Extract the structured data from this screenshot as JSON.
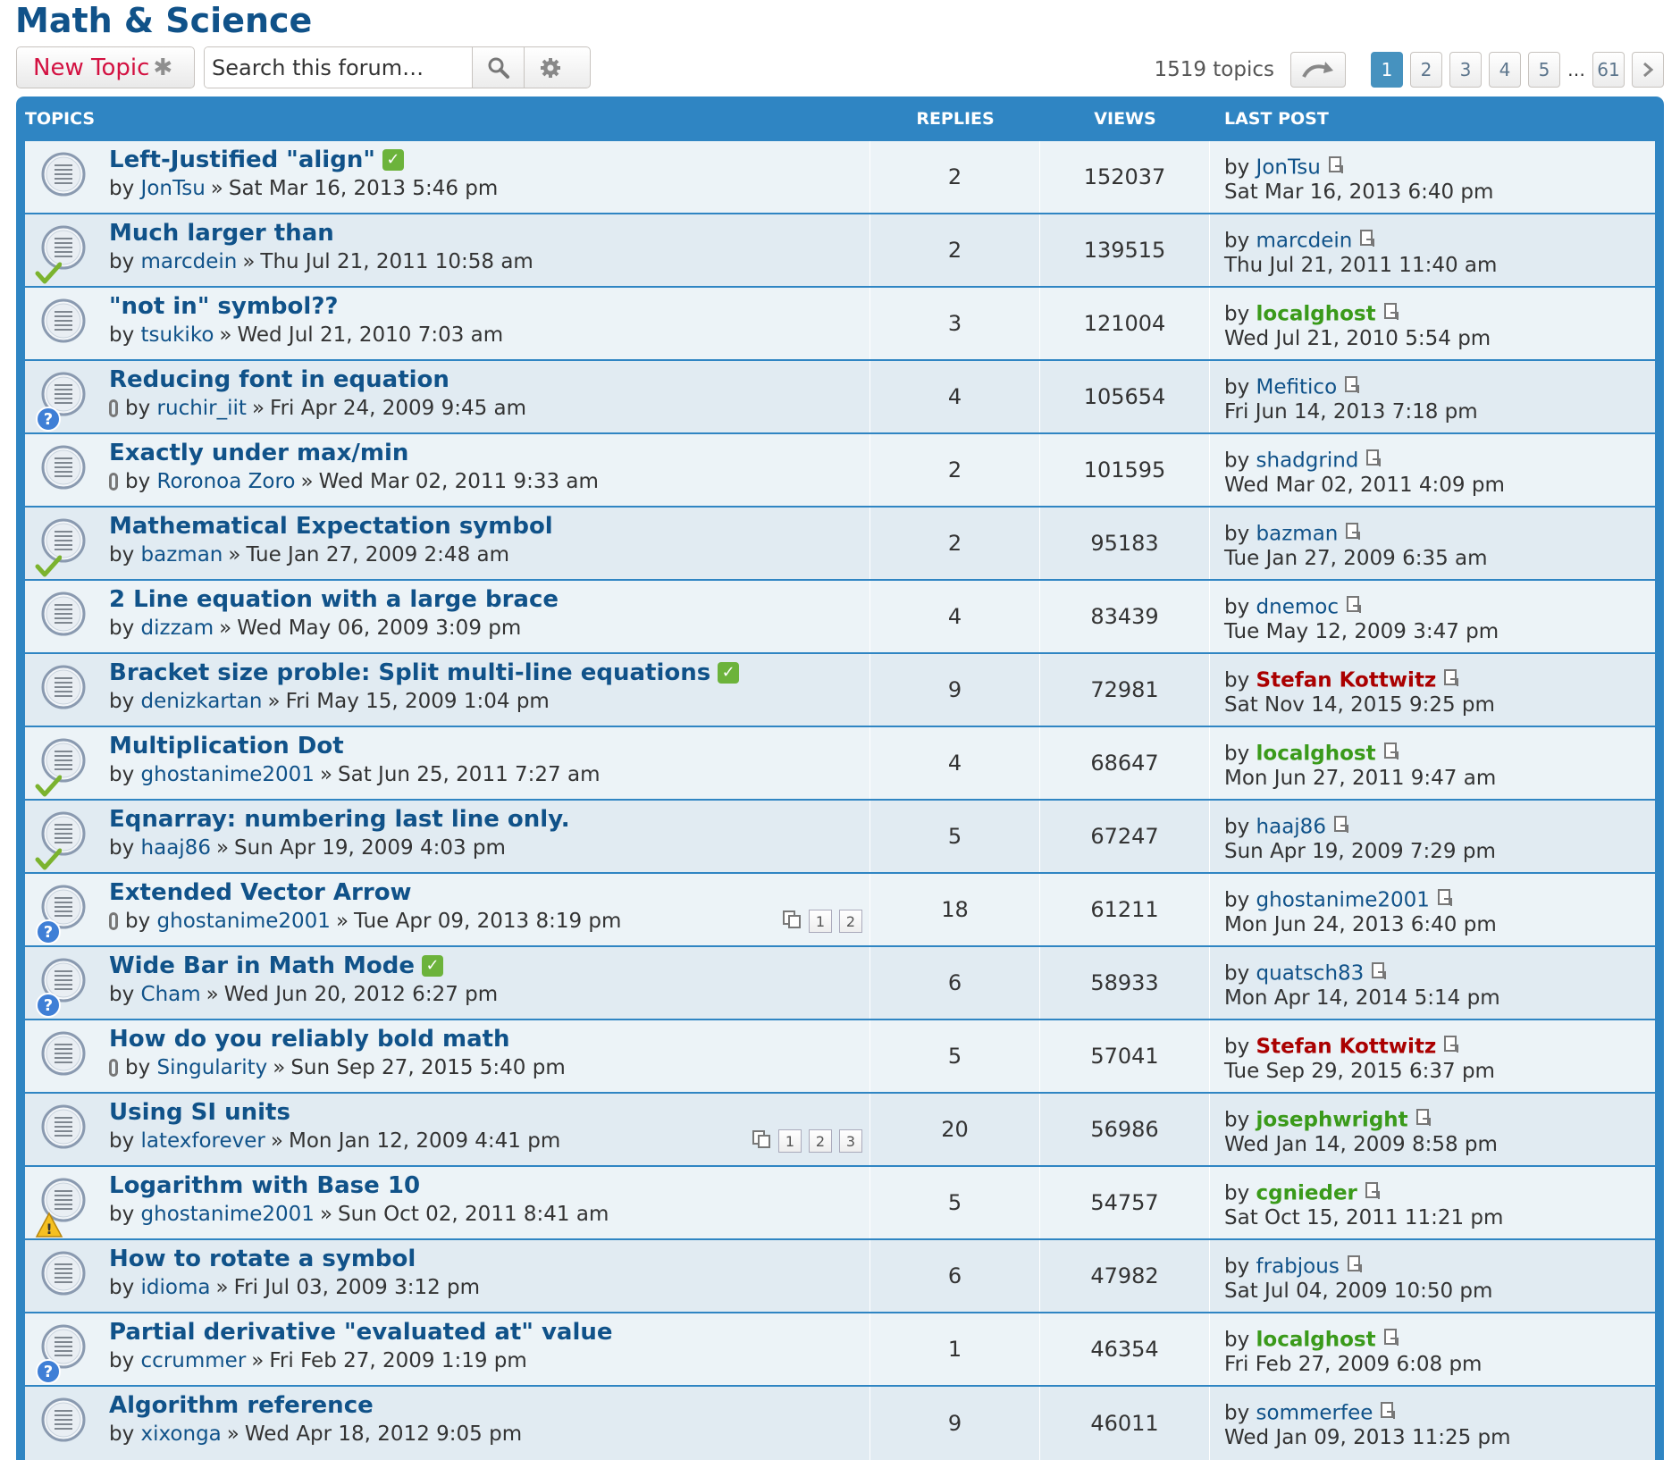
{
  "forum": {
    "title": "Math & Science"
  },
  "actions": {
    "new_topic_label": "New Topic",
    "new_topic_icon": "asterisk-icon",
    "search_placeholder": "Search this forum…",
    "search_icon": "search-icon",
    "advanced_icon": "gear-icon"
  },
  "pagination": {
    "topic_count": "1519 topics",
    "pages": [
      "1",
      "2",
      "3",
      "4",
      "5"
    ],
    "ellipsis": "…",
    "last_page": "61",
    "current": "1"
  },
  "table": {
    "headers": {
      "topics": "TOPICS",
      "replies": "REPLIES",
      "views": "VIEWS",
      "last_post": "LAST POST"
    },
    "by_label": "by",
    "raquo": "»"
  },
  "colors": {
    "accent": "#2f85c3",
    "link": "#105289",
    "row_odd": "#ecf3f7",
    "row_even": "#e1ebf2",
    "moderator": "#aa0000",
    "admin": "#3a9a1a"
  },
  "topics": [
    {
      "title": "Left-Justified \"align\"",
      "solved": true,
      "attachment": false,
      "badge": "",
      "author": "JonTsu",
      "date": "Sat Mar 16, 2013 5:46 pm",
      "replies": "2",
      "views": "152037",
      "last_user": "JonTsu",
      "last_user_style": "normal",
      "last_date": "Sat Mar 16, 2013 6:40 pm",
      "pages": []
    },
    {
      "title": "Much larger than",
      "solved": false,
      "attachment": false,
      "badge": "check",
      "author": "marcdein",
      "date": "Thu Jul 21, 2011 10:58 am",
      "replies": "2",
      "views": "139515",
      "last_user": "marcdein",
      "last_user_style": "normal",
      "last_date": "Thu Jul 21, 2011 11:40 am",
      "pages": []
    },
    {
      "title": "\"not in\" symbol??",
      "solved": false,
      "attachment": false,
      "badge": "",
      "author": "tsukiko",
      "date": "Wed Jul 21, 2010 7:03 am",
      "replies": "3",
      "views": "121004",
      "last_user": "localghost",
      "last_user_style": "green",
      "last_date": "Wed Jul 21, 2010 5:54 pm",
      "pages": []
    },
    {
      "title": "Reducing font in equation",
      "solved": false,
      "attachment": true,
      "badge": "question",
      "author": "ruchir_iit",
      "date": "Fri Apr 24, 2009 9:45 am",
      "replies": "4",
      "views": "105654",
      "last_user": "Mefitico",
      "last_user_style": "normal",
      "last_date": "Fri Jun 14, 2013 7:18 pm",
      "pages": []
    },
    {
      "title": "Exactly under max/min",
      "solved": false,
      "attachment": true,
      "badge": "",
      "author": "Roronoa Zoro",
      "date": "Wed Mar 02, 2011 9:33 am",
      "replies": "2",
      "views": "101595",
      "last_user": "shadgrind",
      "last_user_style": "normal",
      "last_date": "Wed Mar 02, 2011 4:09 pm",
      "pages": []
    },
    {
      "title": "Mathematical Expectation symbol",
      "solved": false,
      "attachment": false,
      "badge": "check",
      "author": "bazman",
      "date": "Tue Jan 27, 2009 2:48 am",
      "replies": "2",
      "views": "95183",
      "last_user": "bazman",
      "last_user_style": "normal",
      "last_date": "Tue Jan 27, 2009 6:35 am",
      "pages": []
    },
    {
      "title": "2 Line equation with a large brace",
      "solved": false,
      "attachment": false,
      "badge": "",
      "author": "dizzam",
      "date": "Wed May 06, 2009 3:09 pm",
      "replies": "4",
      "views": "83439",
      "last_user": "dnemoc",
      "last_user_style": "normal",
      "last_date": "Tue May 12, 2009 3:47 pm",
      "pages": []
    },
    {
      "title": "Bracket size proble: Split multi-line equations",
      "solved": true,
      "attachment": false,
      "badge": "",
      "author": "denizkartan",
      "date": "Fri May 15, 2009 1:04 pm",
      "replies": "9",
      "views": "72981",
      "last_user": "Stefan Kottwitz",
      "last_user_style": "red",
      "last_date": "Sat Nov 14, 2015 9:25 pm",
      "pages": []
    },
    {
      "title": "Multiplication Dot",
      "solved": false,
      "attachment": false,
      "badge": "check",
      "author": "ghostanime2001",
      "date": "Sat Jun 25, 2011 7:27 am",
      "replies": "4",
      "views": "68647",
      "last_user": "localghost",
      "last_user_style": "green",
      "last_date": "Mon Jun 27, 2011 9:47 am",
      "pages": []
    },
    {
      "title": "Eqnarray: numbering last line only.",
      "solved": false,
      "attachment": false,
      "badge": "check",
      "author": "haaj86",
      "date": "Sun Apr 19, 2009 4:03 pm",
      "replies": "5",
      "views": "67247",
      "last_user": "haaj86",
      "last_user_style": "normal",
      "last_date": "Sun Apr 19, 2009 7:29 pm",
      "pages": []
    },
    {
      "title": "Extended Vector Arrow",
      "solved": false,
      "attachment": true,
      "badge": "question",
      "author": "ghostanime2001",
      "date": "Tue Apr 09, 2013 8:19 pm",
      "replies": "18",
      "views": "61211",
      "last_user": "ghostanime2001",
      "last_user_style": "normal",
      "last_date": "Mon Jun 24, 2013 6:40 pm",
      "pages": [
        "1",
        "2"
      ]
    },
    {
      "title": "Wide Bar in Math Mode",
      "solved": true,
      "attachment": false,
      "badge": "question",
      "author": "Cham",
      "date": "Wed Jun 20, 2012 6:27 pm",
      "replies": "6",
      "views": "58933",
      "last_user": "quatsch83",
      "last_user_style": "normal",
      "last_date": "Mon Apr 14, 2014 5:14 pm",
      "pages": []
    },
    {
      "title": "How do you reliably bold math",
      "solved": false,
      "attachment": true,
      "badge": "",
      "author": "Singularity",
      "date": "Sun Sep 27, 2015 5:40 pm",
      "replies": "5",
      "views": "57041",
      "last_user": "Stefan Kottwitz",
      "last_user_style": "red",
      "last_date": "Tue Sep 29, 2015 6:37 pm",
      "pages": []
    },
    {
      "title": "Using SI units",
      "solved": false,
      "attachment": false,
      "badge": "",
      "author": "latexforever",
      "date": "Mon Jan 12, 2009 4:41 pm",
      "replies": "20",
      "views": "56986",
      "last_user": "josephwright",
      "last_user_style": "green",
      "last_date": "Wed Jan 14, 2009 8:58 pm",
      "pages": [
        "1",
        "2",
        "3"
      ]
    },
    {
      "title": "Logarithm with Base 10",
      "solved": false,
      "attachment": false,
      "badge": "warning",
      "author": "ghostanime2001",
      "date": "Sun Oct 02, 2011 8:41 am",
      "replies": "5",
      "views": "54757",
      "last_user": "cgnieder",
      "last_user_style": "green",
      "last_date": "Sat Oct 15, 2011 11:21 pm",
      "pages": []
    },
    {
      "title": "How to rotate a symbol",
      "solved": false,
      "attachment": false,
      "badge": "",
      "author": "idioma",
      "date": "Fri Jul 03, 2009 3:12 pm",
      "replies": "6",
      "views": "47982",
      "last_user": "frabjous",
      "last_user_style": "normal",
      "last_date": "Sat Jul 04, 2009 10:50 pm",
      "pages": []
    },
    {
      "title": "Partial derivative \"evaluated at\" value",
      "solved": false,
      "attachment": false,
      "badge": "question",
      "author": "ccrummer",
      "date": "Fri Feb 27, 2009 1:19 pm",
      "replies": "1",
      "views": "46354",
      "last_user": "localghost",
      "last_user_style": "green",
      "last_date": "Fri Feb 27, 2009 6:08 pm",
      "pages": []
    },
    {
      "title": "Algorithm reference",
      "solved": false,
      "attachment": false,
      "badge": "",
      "author": "xixonga",
      "date": "Wed Apr 18, 2012 9:05 pm",
      "replies": "9",
      "views": "46011",
      "last_user": "sommerfee",
      "last_user_style": "normal",
      "last_date": "Wed Jan 09, 2013 11:25 pm",
      "pages": []
    }
  ]
}
